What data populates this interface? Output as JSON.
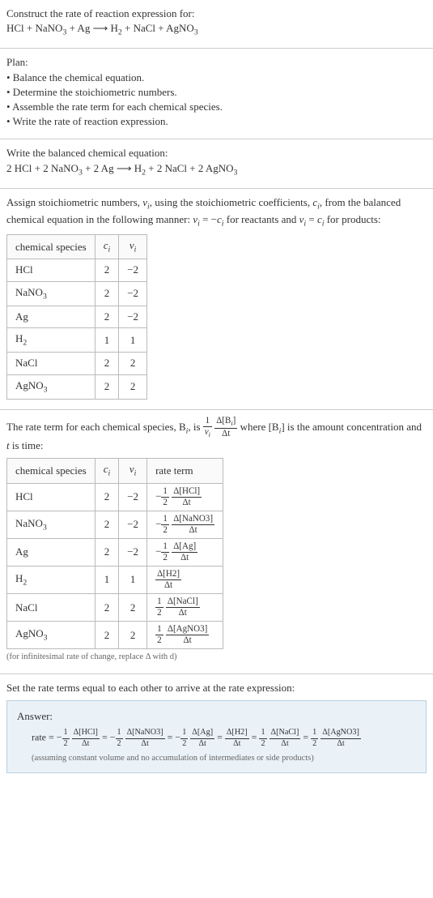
{
  "s1": {
    "line1": "Construct the rate of reaction expression for:",
    "eq_left": "HCl + NaNO",
    "eq_3a": "3",
    "eq_mid1": " + Ag ",
    "arrow": "⟶",
    "eq_mid2": "  H",
    "eq_2a": "2",
    "eq_mid3": " + NaCl + AgNO",
    "eq_3b": "3"
  },
  "s2": {
    "heading": "Plan:",
    "b1": "• Balance the chemical equation.",
    "b2": "• Determine the stoichiometric numbers.",
    "b3": "• Assemble the rate term for each chemical species.",
    "b4": "• Write the rate of reaction expression."
  },
  "s3": {
    "line1": "Write the balanced chemical equation:",
    "eq1": "2 HCl + 2 NaNO",
    "sub1": "3",
    "eq2": " + 2 Ag ",
    "arrow": "⟶",
    "eq3": "  H",
    "sub2": "2",
    "eq4": " + 2 NaCl + 2 AgNO",
    "sub3": "3"
  },
  "s4": {
    "t1": "Assign stoichiometric numbers, ",
    "nu": "ν",
    "i": "i",
    "t2": ", using the stoichiometric coefficients, ",
    "c": "c",
    "t3": ", from the balanced chemical equation in the following manner: ",
    "eq1a": " = −",
    "t4": " for reactants and ",
    "eq2a": " = ",
    "t5": " for products:",
    "h1": "chemical species",
    "h2": "c",
    "h3": "ν",
    "rows": [
      {
        "sp": "HCl",
        "c": "2",
        "v": "−2"
      },
      {
        "sp": "NaNO",
        "sub": "3",
        "c": "2",
        "v": "−2"
      },
      {
        "sp": "Ag",
        "c": "2",
        "v": "−2"
      },
      {
        "sp": "H",
        "sub": "2",
        "c": "1",
        "v": "1"
      },
      {
        "sp": "NaCl",
        "c": "2",
        "v": "2"
      },
      {
        "sp": "AgNO",
        "sub": "3",
        "c": "2",
        "v": "2"
      }
    ]
  },
  "s5": {
    "t1": "The rate term for each chemical species, B",
    "t2": ", is ",
    "num1": "1",
    "den1_a": "ν",
    "num2_a": "Δ[B",
    "num2_b": "]",
    "den2": "Δt",
    "t3": " where [B",
    "t4": "] is the amount concentration and ",
    "t_var": "t",
    "t5": " is time:",
    "h1": "chemical species",
    "h2": "c",
    "h3": "ν",
    "h4": "rate term",
    "rows": [
      {
        "sp": "HCl",
        "c": "2",
        "v": "−2",
        "sign": "−",
        "fnum": "1",
        "fden": "2",
        "dnum": "Δ[HCl]",
        "dden": "Δt"
      },
      {
        "sp": "NaNO",
        "sub": "3",
        "c": "2",
        "v": "−2",
        "sign": "−",
        "fnum": "1",
        "fden": "2",
        "dnum": "Δ[NaNO3]",
        "dden": "Δt"
      },
      {
        "sp": "Ag",
        "c": "2",
        "v": "−2",
        "sign": "−",
        "fnum": "1",
        "fden": "2",
        "dnum": "Δ[Ag]",
        "dden": "Δt"
      },
      {
        "sp": "H",
        "sub": "2",
        "c": "1",
        "v": "1",
        "sign": "",
        "fnum": "",
        "fden": "",
        "dnum": "Δ[H2]",
        "dden": "Δt"
      },
      {
        "sp": "NaCl",
        "c": "2",
        "v": "2",
        "sign": "",
        "fnum": "1",
        "fden": "2",
        "dnum": "Δ[NaCl]",
        "dden": "Δt"
      },
      {
        "sp": "AgNO",
        "sub": "3",
        "c": "2",
        "v": "2",
        "sign": "",
        "fnum": "1",
        "fden": "2",
        "dnum": "Δ[AgNO3]",
        "dden": "Δt"
      }
    ],
    "note": "(for infinitesimal rate of change, replace Δ with d)"
  },
  "s6": {
    "line1": "Set the rate terms equal to each other to arrive at the rate expression:",
    "answer_label": "Answer:",
    "rate_prefix": "rate = ",
    "minus": "−",
    "half_num": "1",
    "half_den": "2",
    "eq": " = ",
    "d_den": "Δt",
    "terms": [
      {
        "sign": "−",
        "half": true,
        "num": "Δ[HCl]"
      },
      {
        "sign": "−",
        "half": true,
        "num": "Δ[NaNO3]"
      },
      {
        "sign": "−",
        "half": true,
        "num": "Δ[Ag]"
      },
      {
        "sign": "",
        "half": false,
        "num": "Δ[H2]"
      },
      {
        "sign": "",
        "half": true,
        "num": "Δ[NaCl]"
      },
      {
        "sign": "",
        "half": true,
        "num": "Δ[AgNO3]"
      }
    ],
    "note": "(assuming constant volume and no accumulation of intermediates or side products)"
  }
}
